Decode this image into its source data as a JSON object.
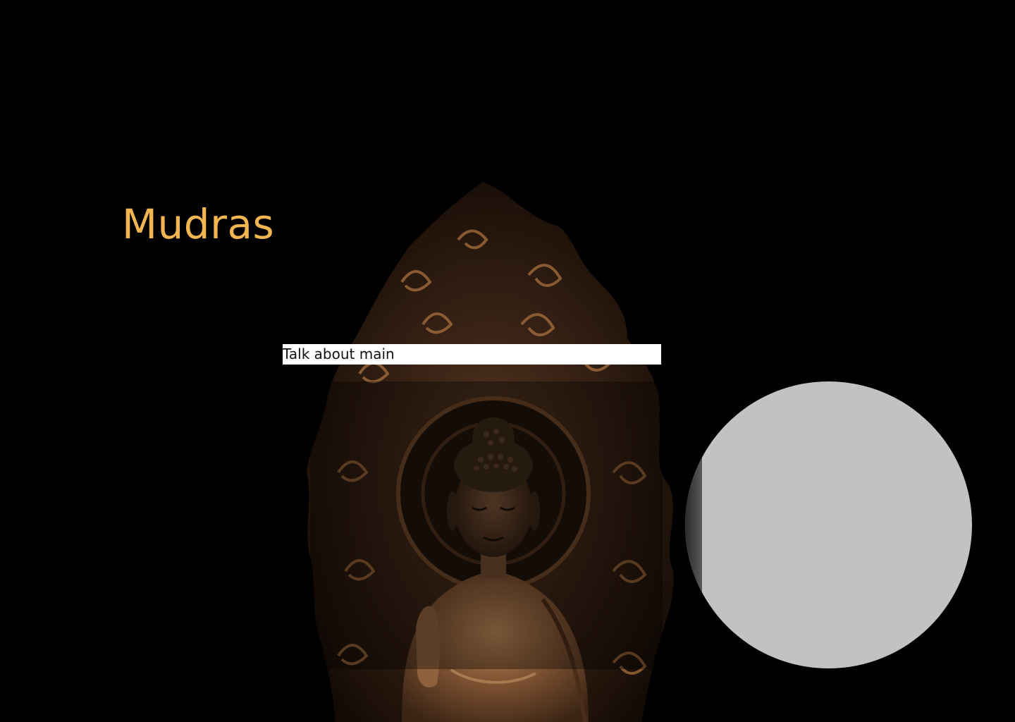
{
  "header": {
    "title": "Mudras"
  },
  "main": {
    "talk_text": "Talk about main"
  },
  "images": {
    "statue": "buddha-statue-image",
    "circle": "placeholder-circle-image"
  },
  "colors": {
    "background": "#000000",
    "title": "#f2b550",
    "circle": "#c2c2c2",
    "text_box": "#ffffff"
  }
}
